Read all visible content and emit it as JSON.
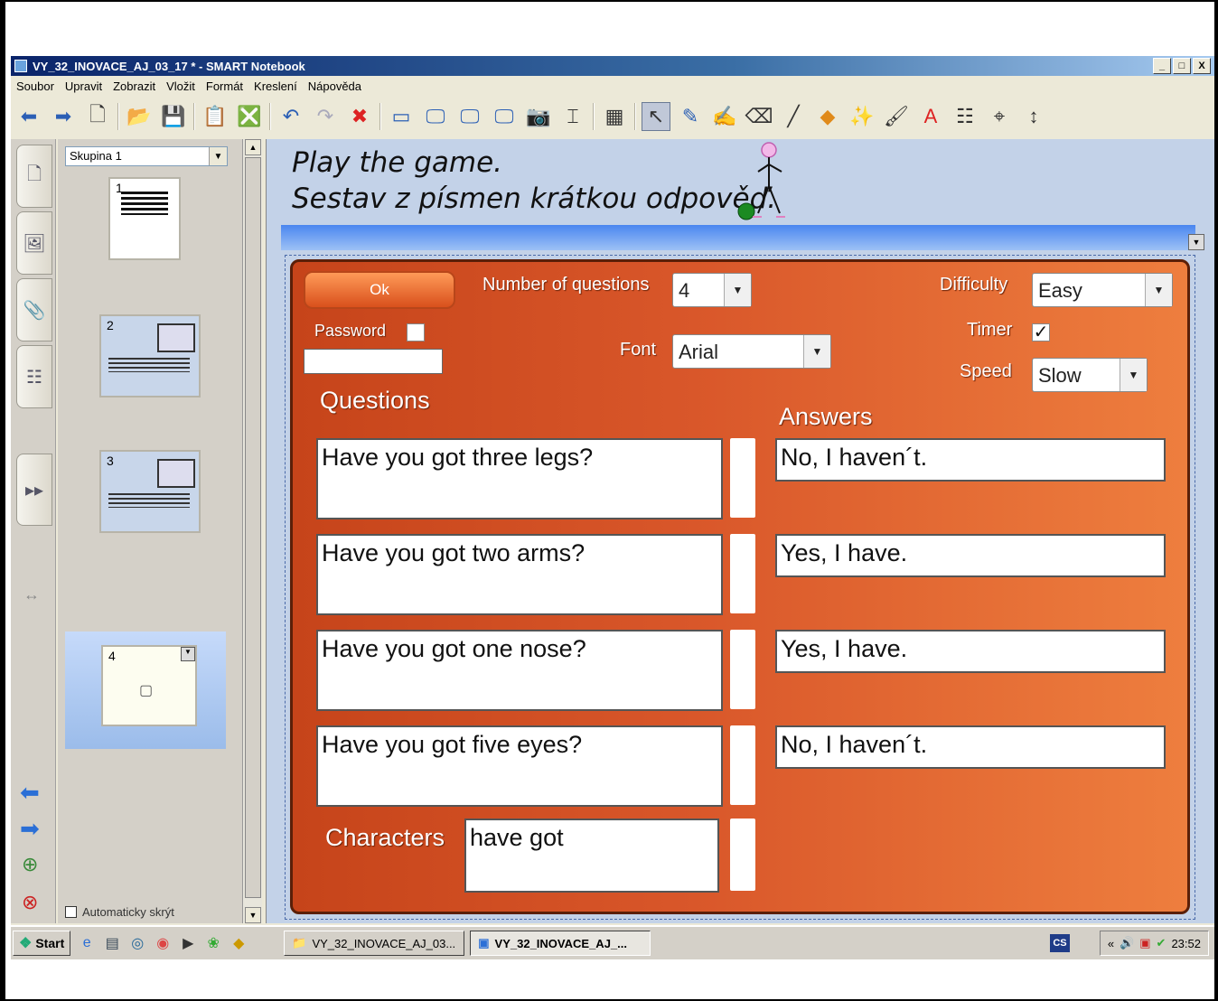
{
  "window": {
    "title": "VY_32_INOVACE_AJ_03_17 * - SMART Notebook",
    "buttons": [
      "_",
      "□",
      "X"
    ]
  },
  "menu": [
    "Soubor",
    "Upravit",
    "Zobrazit",
    "Vložit",
    "Formát",
    "Kreslení",
    "Nápověda"
  ],
  "sorter": {
    "group": "Skupina 1",
    "pages": [
      "1",
      "2",
      "3",
      "4"
    ],
    "autohide_label": "Automaticky skrýt"
  },
  "canvas": {
    "heading_line1": "Play the game.",
    "heading_line2": "Sestav z písmen krátkou odpověď."
  },
  "game": {
    "ok_label": "Ok",
    "number_of_questions_label": "Number of questions",
    "number_of_questions_value": "4",
    "difficulty_label": "Difficulty",
    "difficulty_value": "Easy",
    "password_label": "Password",
    "font_label": "Font",
    "font_value": "Arial",
    "timer_label": "Timer",
    "timer_checked": true,
    "speed_label": "Speed",
    "speed_value": "Slow",
    "questions_label": "Questions",
    "answers_label": "Answers",
    "characters_label": "Characters",
    "characters_value": "have got",
    "questions": [
      "Have you got three legs?",
      "Have you got two arms?",
      "Have you got one nose?",
      "Have you got five eyes?"
    ],
    "answers": [
      "No, I haven´t.",
      "Yes, I have.",
      "Yes, I have.",
      "No, I haven´t."
    ]
  },
  "taskbar": {
    "start_label": "Start",
    "tasks": [
      "VY_32_INOVACE_AJ_03...",
      "VY_32_INOVACE_AJ_..."
    ],
    "lang": "CS",
    "clock": "23:52"
  }
}
